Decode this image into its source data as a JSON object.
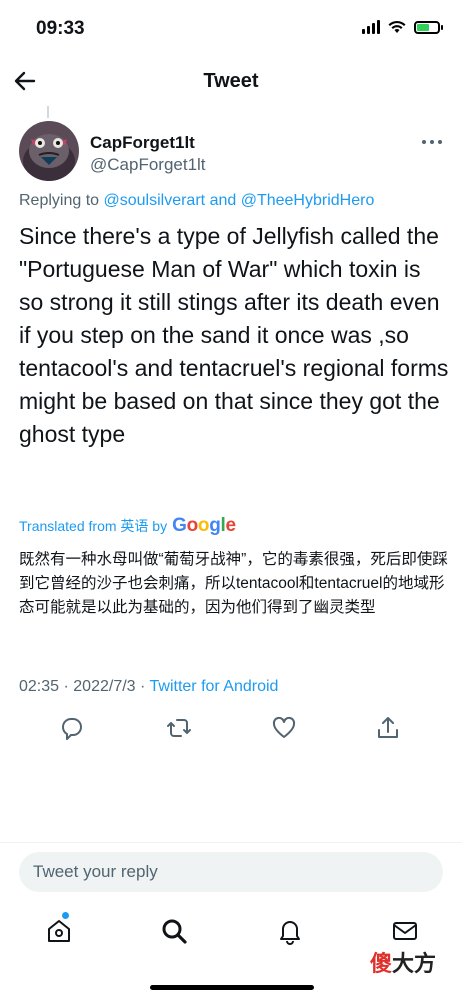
{
  "status_bar": {
    "time": "09:33",
    "battery_level": 0.6,
    "colors": {
      "battery_fill": "#2fd158"
    }
  },
  "header": {
    "title": "Tweet",
    "back_icon": "arrow-left-icon"
  },
  "tweet": {
    "author": {
      "name": "CapForget1lt",
      "handle": "@CapForget1lt"
    },
    "replying_prefix": "Replying to",
    "reply_targets": [
      "@soulsilverart",
      "@TheeHybridHero"
    ],
    "replying_joiner": "and",
    "text": "Since there's a type of Jellyfish called the \"Portuguese Man of War\" which toxin is so strong it still stings after its death even if you step on the sand it once was ,so tentacool's and tentacruel's regional forms might be based on that since they got the ghost type",
    "translation_label": "Translated from 英语 by",
    "translation_provider": "Google",
    "translation": "既然有一种水母叫做“葡萄牙战神”，它的毒素很强，死后即使踩到它曾经的沙子也会刺痛，所以tentacool和tentacruel的地域形态可能就是以此为基础的，因为他们得到了幽灵类型",
    "time": "02:35",
    "date": "2022/7/3",
    "separator": "·",
    "source": "Twitter for Android"
  },
  "actions": [
    "reply-icon",
    "retweet-icon",
    "like-icon",
    "share-icon"
  ],
  "reply_box": {
    "placeholder": "Tweet your reply"
  },
  "tabbar": [
    "home-icon",
    "search-icon",
    "notifications-icon",
    "messages-icon"
  ],
  "watermark": {
    "part1": "傻",
    "part2": "大方"
  },
  "colors": {
    "accent": "#1d9bf0",
    "text_secondary": "#536471",
    "watermark_red": "#e0302b"
  }
}
